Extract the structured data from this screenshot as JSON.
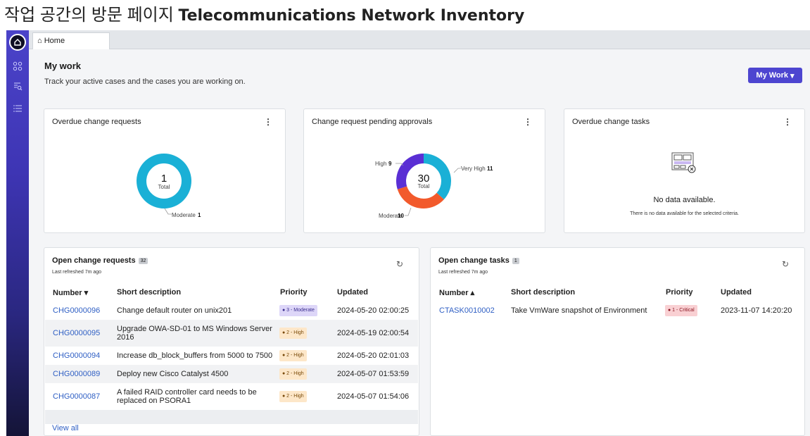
{
  "heading": {
    "korean": "작업 공간의 방문 페이지",
    "title": "Telecommunications Network Inventory"
  },
  "topbar": {
    "tab_home": "Home"
  },
  "sidebar": {
    "items": [
      "home-icon",
      "apps-icon",
      "search-list-icon",
      "list-icon"
    ]
  },
  "mywork": {
    "title": "My work",
    "subtitle": "Track your active cases and the cases you are working on.",
    "button": "My Work",
    "button_caret": "▾"
  },
  "cards": {
    "overdue_requests": {
      "title": "Overdue change requests",
      "center_value": "1",
      "center_label": "Total",
      "legend_label": "Moderate",
      "legend_value": "1"
    },
    "pending_approvals": {
      "title": "Change request pending approvals",
      "center_value": "30",
      "center_label": "Total",
      "labels": {
        "high": "High",
        "very_high": "Very High",
        "moderate": "Moderate"
      },
      "values": {
        "high": "9",
        "very_high": "11",
        "moderate": "10"
      }
    },
    "overdue_tasks": {
      "title": "Overdue change tasks",
      "nodata_title": "No data available.",
      "nodata_sub": "There is no data available for the selected criteria."
    }
  },
  "chart_data": [
    {
      "type": "pie",
      "title": "Overdue change requests",
      "categories": [
        "Moderate"
      ],
      "values": [
        1
      ],
      "total": 1
    },
    {
      "type": "pie",
      "title": "Change request pending approvals",
      "categories": [
        "Very High",
        "Moderate",
        "High"
      ],
      "values": [
        11,
        10,
        9
      ],
      "total": 30
    }
  ],
  "open_requests": {
    "title": "Open change requests",
    "count": "32",
    "refreshed": "Last refreshed 7m ago",
    "headers": {
      "number": "Number ▾",
      "desc": "Short description",
      "priority": "Priority",
      "updated": "Updated"
    },
    "rows": [
      {
        "number": "CHG0000096",
        "desc": "Change default router on unix201",
        "priority": "● 3 - Moderate",
        "updated": "2024-05-20 02:00:25"
      },
      {
        "number": "CHG0000095",
        "desc": "Upgrade OWA-SD-01 to MS Windows Server 2016",
        "priority": "● 2 - High",
        "updated": "2024-05-19 02:00:54"
      },
      {
        "number": "CHG0000094",
        "desc": "Increase db_block_buffers from 5000 to 7500",
        "priority": "● 2 - High",
        "updated": "2024-05-20 02:01:03"
      },
      {
        "number": "CHG0000089",
        "desc": "Deploy new Cisco Catalyst 4500",
        "priority": "● 2 - High",
        "updated": "2024-05-07 01:53:59"
      },
      {
        "number": "CHG0000087",
        "desc": "A failed RAID controller card needs to be replaced on PSORA1",
        "priority": "● 2 - High",
        "updated": "2024-05-07 01:54:06"
      }
    ],
    "view_all": "View all"
  },
  "open_tasks": {
    "title": "Open change tasks",
    "count": "1",
    "refreshed": "Last refreshed 7m ago",
    "headers": {
      "number": "Number ▴",
      "desc": "Short description",
      "priority": "Priority",
      "updated": "Updated"
    },
    "rows": [
      {
        "number": "CTASK0010002",
        "desc": "Take VmWare snapshot of Environment",
        "priority": "● 1 - Critical",
        "updated": "2023-11-07 14:20:20"
      }
    ]
  },
  "colors": {
    "accent": "#4d45d0",
    "moderate": "#1ab0d6",
    "high": "#5a2fd4",
    "very_high": "#1ab0d6",
    "moderate_slice": "#f25a2c"
  }
}
